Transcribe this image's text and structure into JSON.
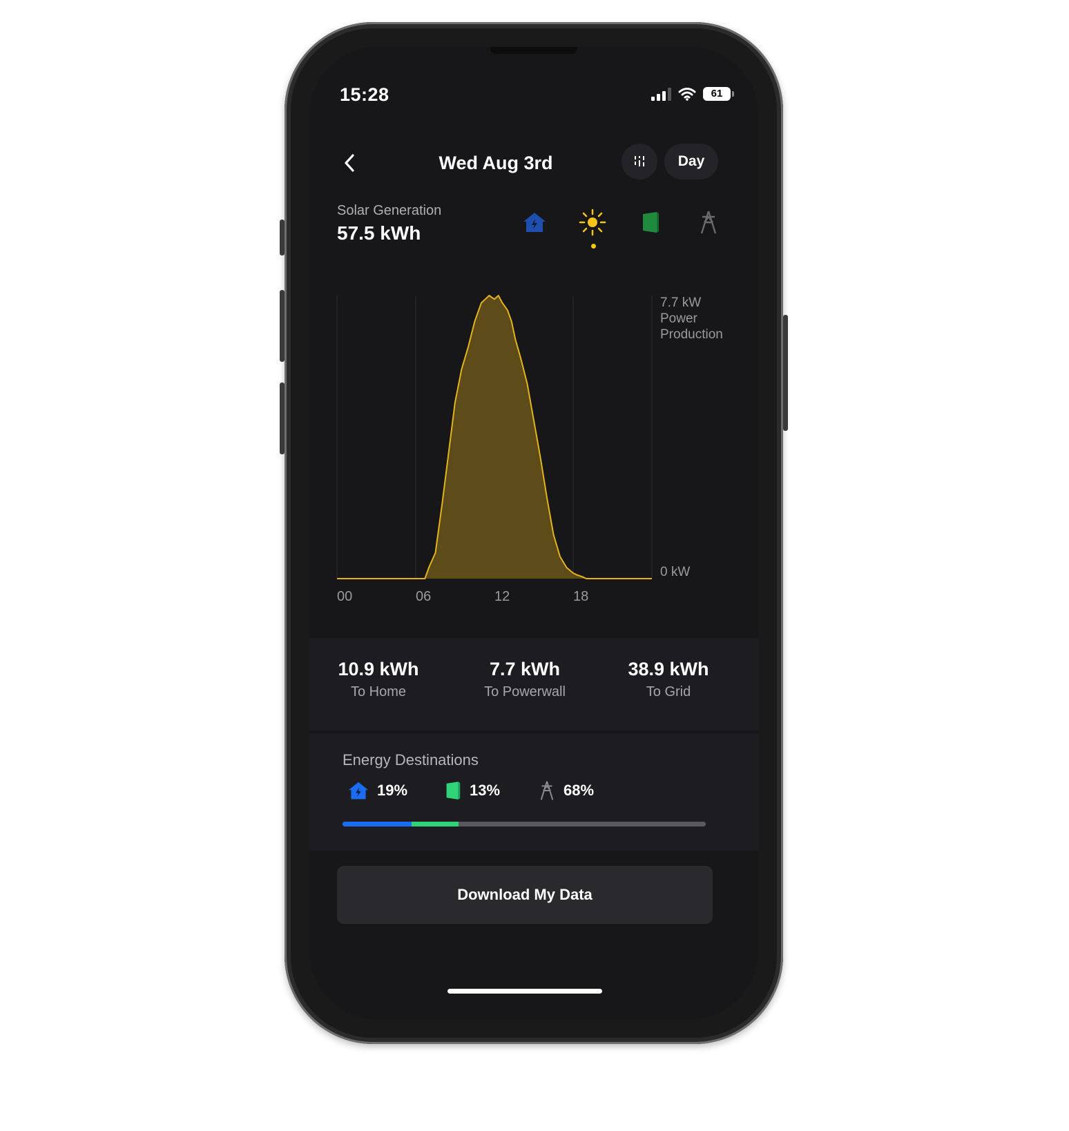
{
  "status_bar": {
    "time": "15:28",
    "battery": "61"
  },
  "nav": {
    "title": "Wed Aug 3rd",
    "period": "Day"
  },
  "summary": {
    "label": "Solar Generation",
    "value": "57.5 kWh"
  },
  "sources": [
    {
      "name": "home",
      "icon": "home-bolt-icon",
      "color": "#1e4fae",
      "selected": false
    },
    {
      "name": "solar",
      "icon": "sun-icon",
      "color": "#f5c518",
      "selected": true
    },
    {
      "name": "powerwall",
      "icon": "powerwall-icon",
      "color": "#1f8a3e",
      "selected": false
    },
    {
      "name": "grid",
      "icon": "grid-tower-icon",
      "color": "#6a6a6e",
      "selected": false
    }
  ],
  "chart_data": {
    "type": "area",
    "x_ticks": [
      "00",
      "06",
      "12",
      "18"
    ],
    "y_max_label": "7.7 kW",
    "y_max_caption_1": "Power",
    "y_max_caption_2": "Production",
    "y_min_label": "0 kW",
    "ylim": [
      0,
      7.7
    ],
    "xlim": [
      0,
      24
    ],
    "line_color": "#e3b41c",
    "fill_color": "#5e4b1a",
    "series": [
      {
        "x": [
          0,
          6.7,
          7,
          7.5,
          8,
          8.5,
          9,
          9.5,
          10,
          10.5,
          11,
          11.3,
          11.6,
          12,
          12.3,
          12.6,
          13,
          13.3,
          13.6,
          14,
          14.5,
          15,
          15.5,
          16,
          16.5,
          17,
          17.5,
          18,
          18.3,
          18.7,
          19,
          24
        ],
        "y": [
          0,
          0,
          0.3,
          0.7,
          2.0,
          3.4,
          4.8,
          5.7,
          6.3,
          7.0,
          7.5,
          7.6,
          7.7,
          7.6,
          7.7,
          7.5,
          7.3,
          7.0,
          6.5,
          6.0,
          5.3,
          4.3,
          3.3,
          2.2,
          1.2,
          0.6,
          0.3,
          0.15,
          0.1,
          0.05,
          0,
          0
        ]
      }
    ],
    "grid": true
  },
  "stats": [
    {
      "value": "10.9 kWh",
      "label": "To Home"
    },
    {
      "value": "7.7 kWh",
      "label": "To Powerwall"
    },
    {
      "value": "38.9 kWh",
      "label": "To Grid"
    }
  ],
  "destinations": {
    "title": "Energy Destinations",
    "items": [
      {
        "icon": "home-bolt-icon",
        "percent_label": "19%",
        "percent": 19,
        "color": "#1a6cf0"
      },
      {
        "icon": "powerwall-icon",
        "percent_label": "13%",
        "percent": 13,
        "color": "#2fd37a"
      },
      {
        "icon": "grid-tower-icon",
        "percent_label": "68%",
        "percent": 68,
        "color": "#5a5a5e"
      }
    ]
  },
  "download_label": "Download My Data"
}
